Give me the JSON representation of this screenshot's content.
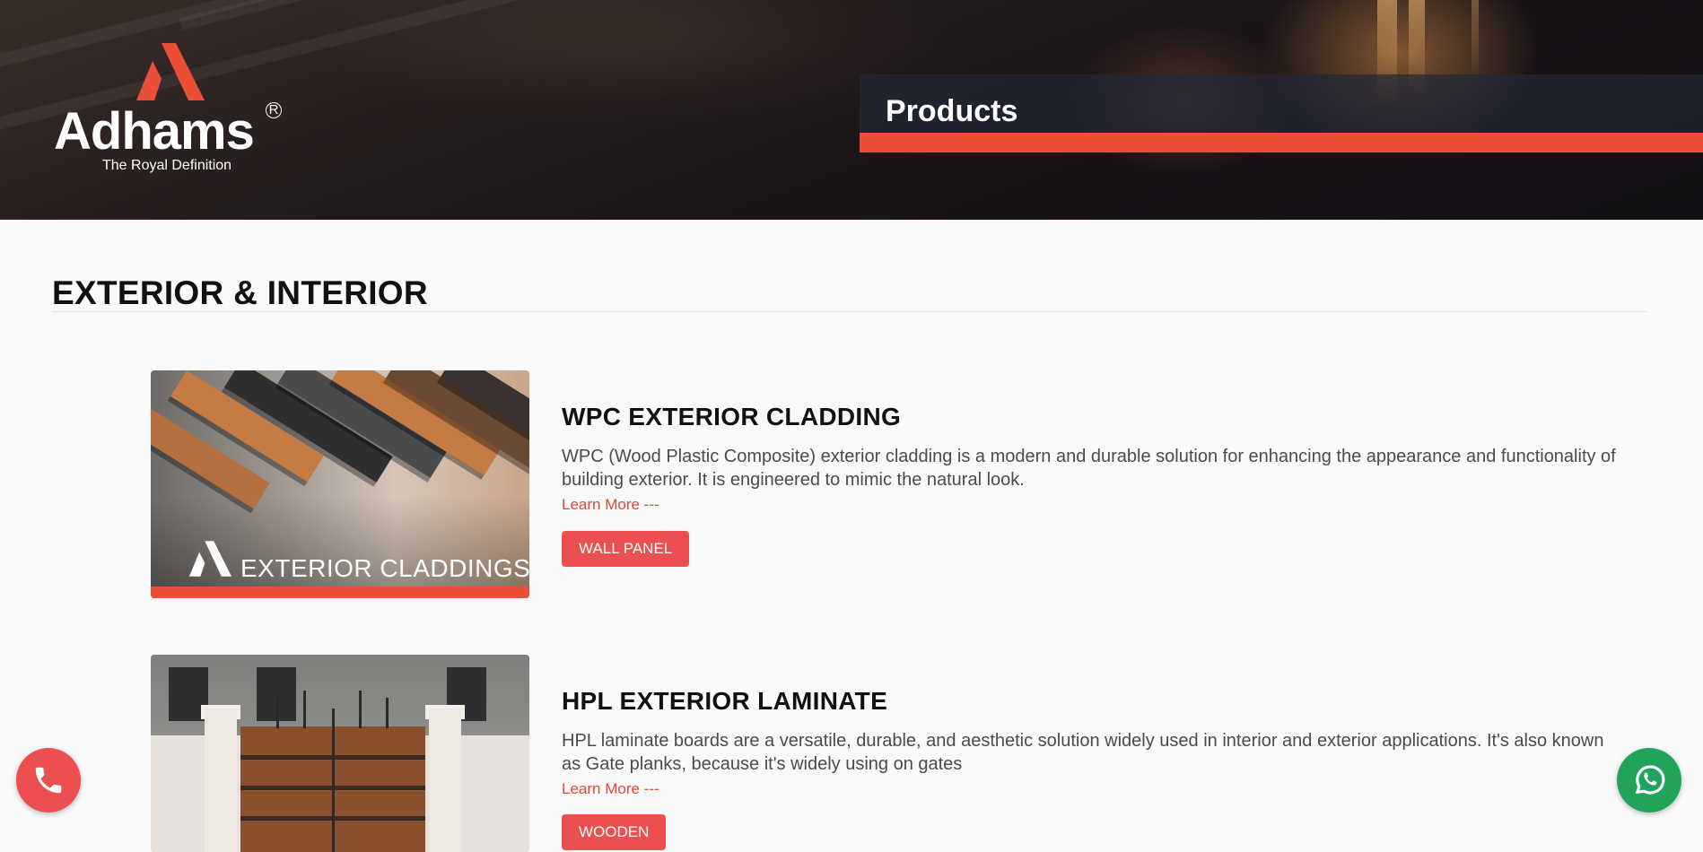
{
  "colors": {
    "accent": "#ec4f37",
    "button": "#ec4f4f",
    "whatsapp": "#22a35a",
    "link": "#e0483c"
  },
  "logo": {
    "brand": "Adhams",
    "registered": "R",
    "tagline": "The Royal Definition"
  },
  "header": {
    "page_title": "Products"
  },
  "section": {
    "title": "EXTERIOR & INTERIOR"
  },
  "products": [
    {
      "title": "WPC EXTERIOR CLADDING",
      "description": "WPC (Wood Plastic Composite) exterior cladding is a modern and durable solution for enhancing the appearance and functionality of building exterior. It is engineered to mimic the natural look.",
      "learn_more": "Learn More ---",
      "tag": "WALL PANEL",
      "image_caption": "EXTERIOR CLADDINGS"
    },
    {
      "title": "HPL EXTERIOR LAMINATE",
      "description": "HPL laminate boards are a versatile, durable, and aesthetic solution widely used in interior and exterior applications. It's also known as Gate planks, because it's widely using on gates",
      "learn_more": "Learn More ---",
      "tag": "WOODEN"
    }
  ],
  "floating": {
    "call_icon": "phone-icon",
    "whatsapp_icon": "whatsapp-icon"
  }
}
